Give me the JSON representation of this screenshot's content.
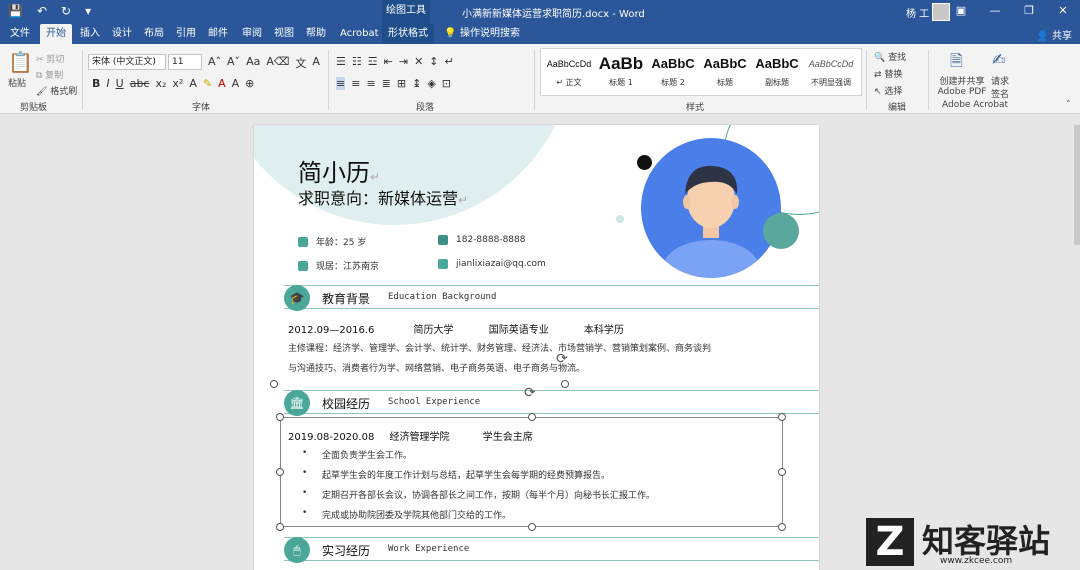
{
  "titlebar": {
    "qat": [
      "💾",
      "↶",
      "↻",
      "▾"
    ],
    "context_tools": "绘图工具",
    "doc_title": "小满新新媒体运营求职简历.docx - Word",
    "user": "杨 工",
    "win": [
      "▣",
      "—",
      "❐",
      "✕"
    ]
  },
  "tabs": {
    "items": [
      "文件",
      "开始",
      "插入",
      "设计",
      "布局",
      "引用",
      "邮件",
      "审阅",
      "视图",
      "帮助",
      "Acrobat",
      "形状格式"
    ],
    "search": "操作说明搜索",
    "share": "共享"
  },
  "ribbon": {
    "clipboard": {
      "paste": "粘贴",
      "cut": "剪切",
      "copy": "复制",
      "painter": "格式刷",
      "label": "剪贴板"
    },
    "font": {
      "name": "宋体 (中文正文)",
      "size": "11",
      "label": "字体"
    },
    "paragraph": {
      "label": "段落"
    },
    "styles": {
      "label": "样式",
      "items": [
        {
          "preview": "AaBbCcDd",
          "name": "↵ 正文"
        },
        {
          "preview": "AaBb",
          "name": "标题 1"
        },
        {
          "preview": "AaBbC",
          "name": "标题 2"
        },
        {
          "preview": "AaBbC",
          "name": "标题"
        },
        {
          "preview": "AaBbC",
          "name": "副标题"
        },
        {
          "preview": "AaBbCcDd",
          "name": "不明显强调"
        }
      ]
    },
    "editing": {
      "find": "查找",
      "replace": "替换",
      "select": "选择",
      "label": "编辑"
    },
    "acrobat": {
      "create": "创建并共享",
      "create2": "Adobe PDF",
      "sign": "请求",
      "sign2": "签名",
      "label": "Adobe Acrobat"
    }
  },
  "resume": {
    "name": "简小历",
    "intent": "求职意向：新媒体运营",
    "age": "年龄：25 岁",
    "phone": "182-8888-8888",
    "location": "现居：江苏南京",
    "email": "jianlixiazai@qq.com",
    "pilcrow": "↵",
    "education": {
      "title_cn": "教育背景",
      "title_en": "Education Background",
      "period": "2012.09—2016.6",
      "school": "简历大学",
      "major": "国际英语专业",
      "degree": "本科学历",
      "courses_1": "主修课程：经济学、管理学、会计学、统计学、财务管理、经济法、市场营销学、营销策划案例、商务谈判",
      "courses_2": "与沟通技巧、消费者行为学、网络营销、电子商务英语、电子商务与物流。"
    },
    "campus": {
      "title_cn": "校园经历",
      "title_en": "School Experience",
      "period": "2019.08-2020.08",
      "org": "经济管理学院",
      "role": "学生会主席",
      "bullets": [
        "全面负责学生会工作。",
        "起草学生会的年度工作计划与总结，起草学生会每学期的经费预算报告。",
        "定期召开各部长会议，协调各部长之间工作，按期（每半个月）向秘书长汇报工作。",
        "完成或协助院团委及学院其他部门交给的工作。"
      ]
    },
    "work": {
      "title_cn": "实习经历",
      "title_en": "Work Experience"
    }
  },
  "watermark": {
    "logo": "Z",
    "text": "知客驿站",
    "url": "www.zkcee.com"
  }
}
